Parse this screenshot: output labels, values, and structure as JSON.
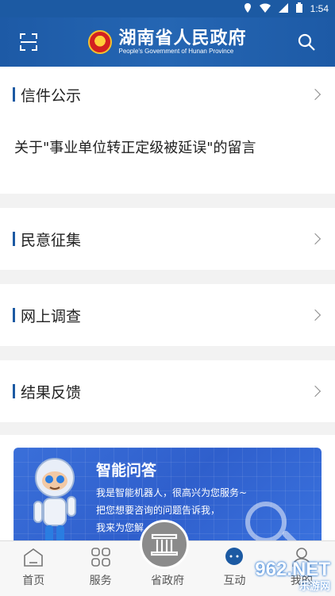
{
  "status_bar": {
    "time": "1:54"
  },
  "header": {
    "title": "湖南省人民政府",
    "subtitle": "People's Government of Hunan Province"
  },
  "sections": [
    {
      "label": "信件公示",
      "message": "关于\"事业单位转正定级被延误\"的留言"
    },
    {
      "label": "民意征集"
    },
    {
      "label": "网上调查"
    },
    {
      "label": "结果反馈"
    }
  ],
  "banner": {
    "title": "智能问答",
    "lines": [
      "我是智能机器人，很高兴为您服务~",
      "把您想要咨询的问题告诉我，",
      "我来为您解"
    ]
  },
  "tabbar": {
    "items": [
      {
        "label": "首页",
        "icon": "home-icon"
      },
      {
        "label": "服务",
        "icon": "grid-icon"
      },
      {
        "label": "省政府",
        "icon": "government-building-icon"
      },
      {
        "label": "互动",
        "icon": "chat-icon"
      },
      {
        "label": "我的",
        "icon": "user-icon"
      }
    ]
  },
  "watermark": {
    "text": "962.NET",
    "sub": "乐游网"
  },
  "colors": {
    "brand_blue": "#1c5aa3",
    "banner_blue": "#3a6fd9"
  }
}
